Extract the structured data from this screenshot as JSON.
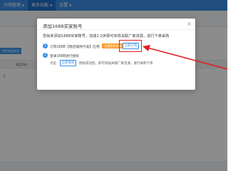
{
  "topnav": {
    "items": [
      {
        "label": "分销管理"
      },
      {
        "label": "更多功能"
      },
      {
        "label": "设置"
      }
    ]
  },
  "background": {
    "button_label": "同步商品关系",
    "column_label": "商品资料",
    "row_text": "订"
  },
  "dialog": {
    "title": "添加1688买家账号",
    "intro": "您尚未添加1688买家账号，完成1-2步即可实现关联厂家货源，进行下单采购",
    "steps": [
      {
        "number": "1",
        "text": "订购1688【网店铺供代发】应用",
        "tag": "去铺货供应商",
        "button": "立即订购"
      },
      {
        "number": "2",
        "text": "登录1688进行授权"
      }
    ],
    "auth_status_label": "点击",
    "auth_button": "立即授权",
    "auth_note": "授权成功后，即可添加关联厂家货源，进行采购下单"
  },
  "colors": {
    "primary": "#3a8ee6",
    "tag": "#ff9a2e",
    "highlight": "#e02020"
  }
}
